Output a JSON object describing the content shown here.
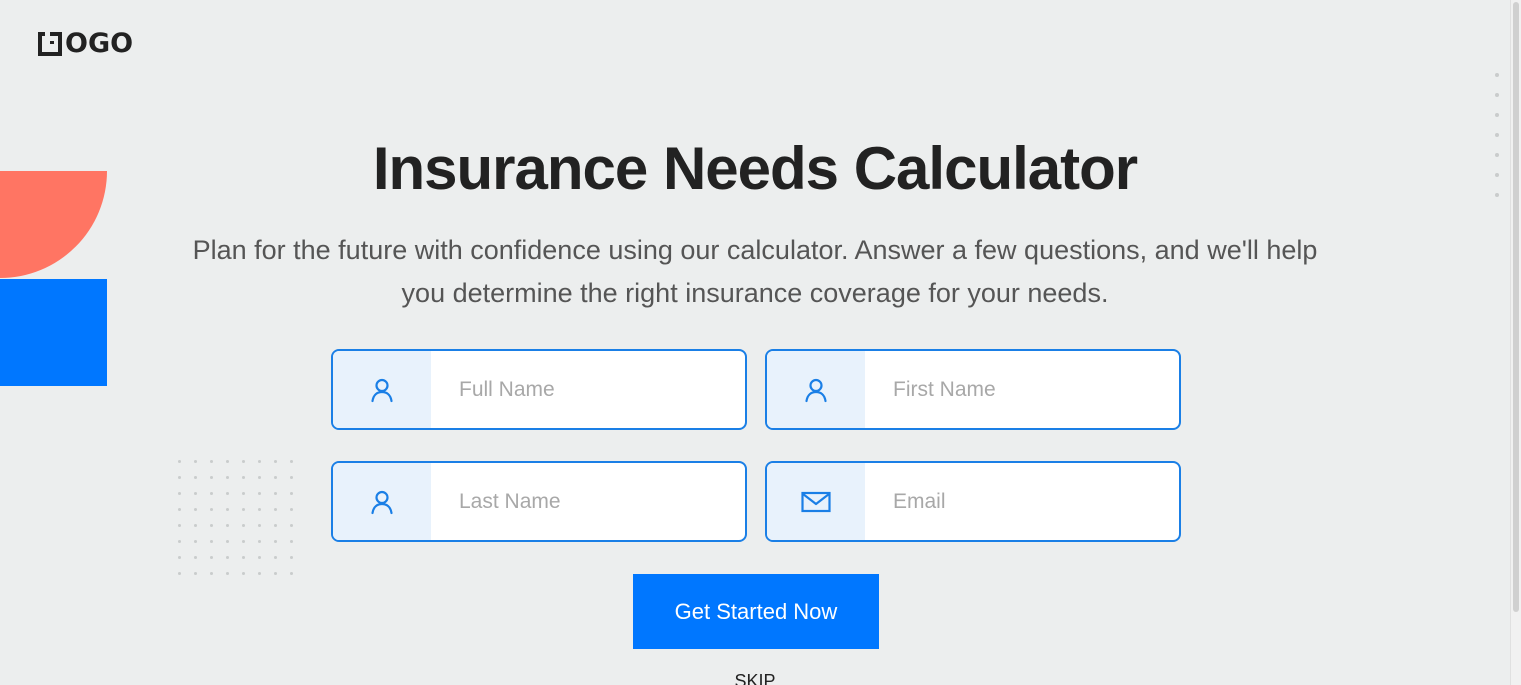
{
  "brand": {
    "logo_text": "OGO"
  },
  "hero": {
    "title": "Insurance Needs Calculator",
    "subtitle": "Plan for the future with confidence using our calculator. Answer a few questions, and we'll help you determine the right insurance coverage for your needs."
  },
  "form": {
    "fields": [
      {
        "icon": "user-icon",
        "value": "",
        "placeholder": "Full Name"
      },
      {
        "icon": "user-icon",
        "value": "",
        "placeholder": "First Name"
      },
      {
        "icon": "user-icon",
        "value": "",
        "placeholder": "Last Name"
      },
      {
        "icon": "mail-icon",
        "value": "",
        "placeholder": "Email"
      }
    ],
    "submit_label": "Get Started Now",
    "skip_label": "SKIP"
  },
  "colors": {
    "accent": "#0077ff",
    "field_border": "#1a7fe6",
    "icon_bg": "#e8f2fc",
    "coral": "#ff7563",
    "background": "#eceeee"
  }
}
